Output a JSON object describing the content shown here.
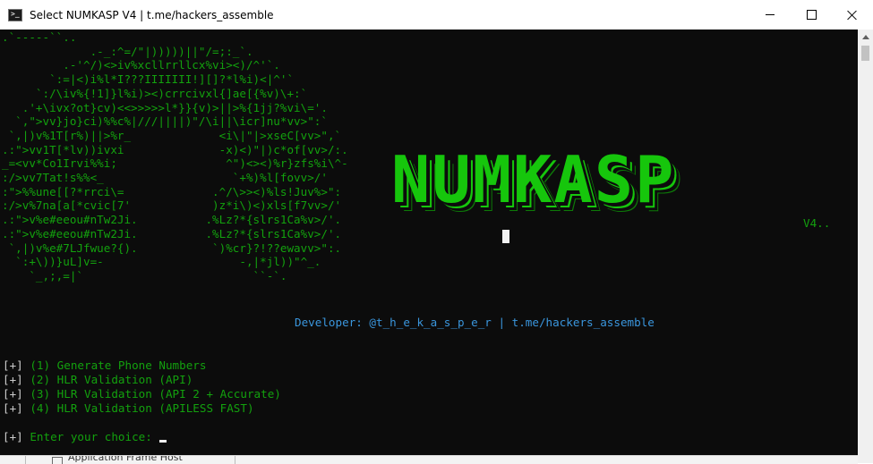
{
  "window": {
    "title": "Select NUMKASP V4 | t.me/hackers_assemble"
  },
  "console": {
    "ascii_art": ".`-----``..\n             .-_:^=/\"|)))))||\"/=;:_`.\n         .-'^/)<>iv%xcllrrllcx%vi><)/^'`.\n       `:=|<)i%l*I???IIIIIII!][]?*l%i)<|^'`\n     `:/\\iv%{!1]}l%i)><)crrcivxl{]ae[{%v)\\+:`\n   .'+\\ivx?ot}cv)<<>>>>>l*}}{v)>||>%{1jj?%vi\\='.\n  `,\">vv}jo}ci)%%c%|///||||)\"/\\i||\\icr]nu*vv>\":`\n `,|)v%1T[r%)||>%r_             <i\\|\"|>xseC[vv>\",`\n.:\">vv1T[*lv))ivxi              -x)<)\"|)c*of[vv>/:.\n_=<vv*Co1Irvi%%i;                ^\")<><)%r}zfs%i\\^-\n:/>vv7Tat!s%%<_                   `+%)%l[fovv>/'\n:\">%%une[[?*rrci\\=             .^/\\>><)%ls!Juv%>\":\n:/>v%7na[a[*cvic[7'            )z*i\\)<)xls[f7vv>/'\n.:\">v%e#eeou#nTw2Ji.          .%Lz?*{slrs1Ca%v>/'.\n.:\">v%e#eeou#nTw2Ji.          .%Lz?*{slrs1Ca%v>/'.\n `,|)v%e#7LJfwue?{).           `)%cr}?!??ewavv>\":.\n  `:+\\))}uL]v=-                    -,|*jl))\"^_.\n    `_,;,=|`                         ``-`.",
    "logo": "NUMKASP",
    "version": "V4..",
    "developer_line": "Developer: @t_h_e_k_a_s_p_e_r | t.me/hackers_assemble",
    "menu": [
      {
        "marker": "[+]",
        "text": " (1) Generate Phone Numbers"
      },
      {
        "marker": "[+]",
        "text": " (2) HLR Validation (API)"
      },
      {
        "marker": "[+]",
        "text": " (3) HLR Validation (API 2 + Accurate)"
      },
      {
        "marker": "[+]",
        "text": " (4) HLR Validation (APILESS FAST)"
      }
    ],
    "prompt": {
      "marker": "[+]",
      "text": " Enter your choice:"
    }
  },
  "taskbar": {
    "item_label": "Application Frame Host"
  },
  "colors": {
    "console_bg": "#0c0c0c",
    "green": "#13a10e",
    "bright_green": "#16c60c",
    "blue": "#3a96dd",
    "gray": "#cccccc"
  },
  "icons": [
    "console-icon",
    "minimize-icon",
    "maximize-icon",
    "close-icon",
    "scroll-up-arrow-icon"
  ]
}
